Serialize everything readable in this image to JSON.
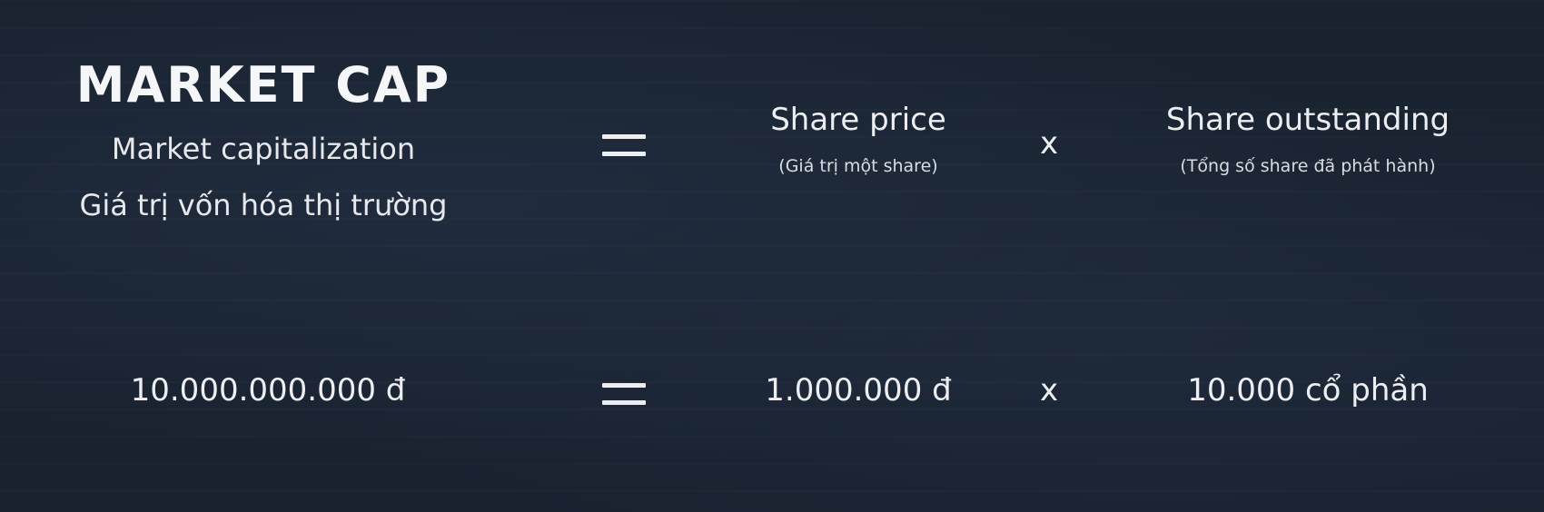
{
  "formula": {
    "title": "MARKET CAP",
    "subtitle_en": "Market capitalization",
    "subtitle_vi": "Giá trị vốn hóa thị trường",
    "equals_icon": "equals-icon",
    "term1_label": "Share price",
    "term1_note": "(Giá trị một share)",
    "times_symbol": "x",
    "term2_label": "Share outstanding",
    "term2_note": "(Tổng số share đã phát hành)"
  },
  "example": {
    "result": "10.000.000.000 đ",
    "equals_icon": "equals-icon",
    "price": "1.000.000 đ",
    "times_symbol": "x",
    "shares": "10.000 cổ phần"
  },
  "colors": {
    "background": "#19222f",
    "text": "#eceef1"
  }
}
